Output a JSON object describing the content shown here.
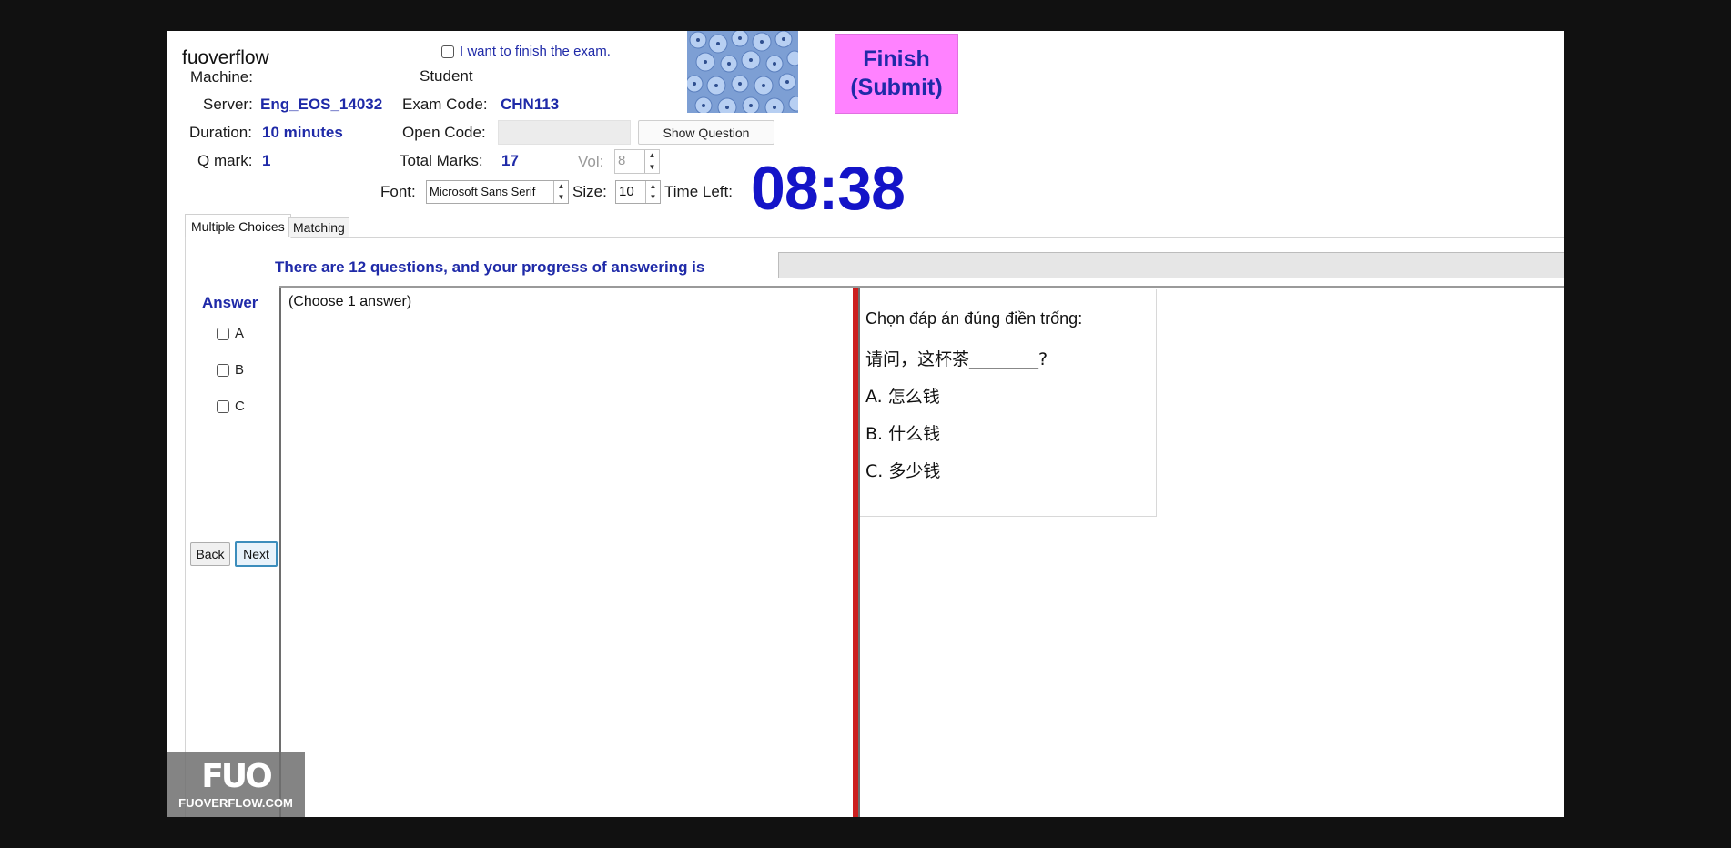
{
  "header": {
    "watermark_text": "fuoverflow",
    "finish_checkbox_label": "I want to finish the exam.",
    "machine_label": "Machine:",
    "student_label": "Student",
    "server_label": "Server:",
    "server_value": "Eng_EOS_14032",
    "exam_code_label": "Exam Code:",
    "exam_code_value": "CHN113",
    "duration_label": "Duration:",
    "duration_value": "10 minutes",
    "open_code_label": "Open Code:",
    "show_question_label": "Show Question",
    "qmark_label": "Q mark:",
    "qmark_value": "1",
    "total_marks_label": "Total Marks:",
    "total_marks_value": "17",
    "vol_label": "Vol:",
    "vol_value": "8",
    "font_label": "Font:",
    "font_value": "Microsoft Sans Serif",
    "size_label": "Size:",
    "size_value": "10",
    "time_left_label": "Time Left:",
    "time_left_value": "08:38",
    "finish_button_line1": "Finish",
    "finish_button_line2": "(Submit)"
  },
  "tabs": [
    {
      "label": "Multiple Choices",
      "active": true
    },
    {
      "label": "Matching",
      "active": false
    }
  ],
  "progress": {
    "text": "There are 12 questions, and your progress of answering is",
    "fraction": 0
  },
  "answer": {
    "title": "Answer",
    "options": [
      "A",
      "B",
      "C"
    ],
    "back_label": "Back",
    "next_label": "Next"
  },
  "choose_hint": "(Choose 1 answer)",
  "question": {
    "instruction": "Chọn đáp án đúng điền trống:",
    "sentence": "请问，这杯茶________?",
    "options": [
      "A. 怎么钱",
      "B. 什么钱",
      "C. 多少钱"
    ]
  },
  "logo": {
    "mark": "FUO",
    "site": "FUOVERFLOW.COM"
  },
  "colors": {
    "accent_blue": "#1f2aa8",
    "timer_blue": "#1414c8",
    "finish_pink": "#ff82ff",
    "divider_red": "#cc1f1f"
  }
}
